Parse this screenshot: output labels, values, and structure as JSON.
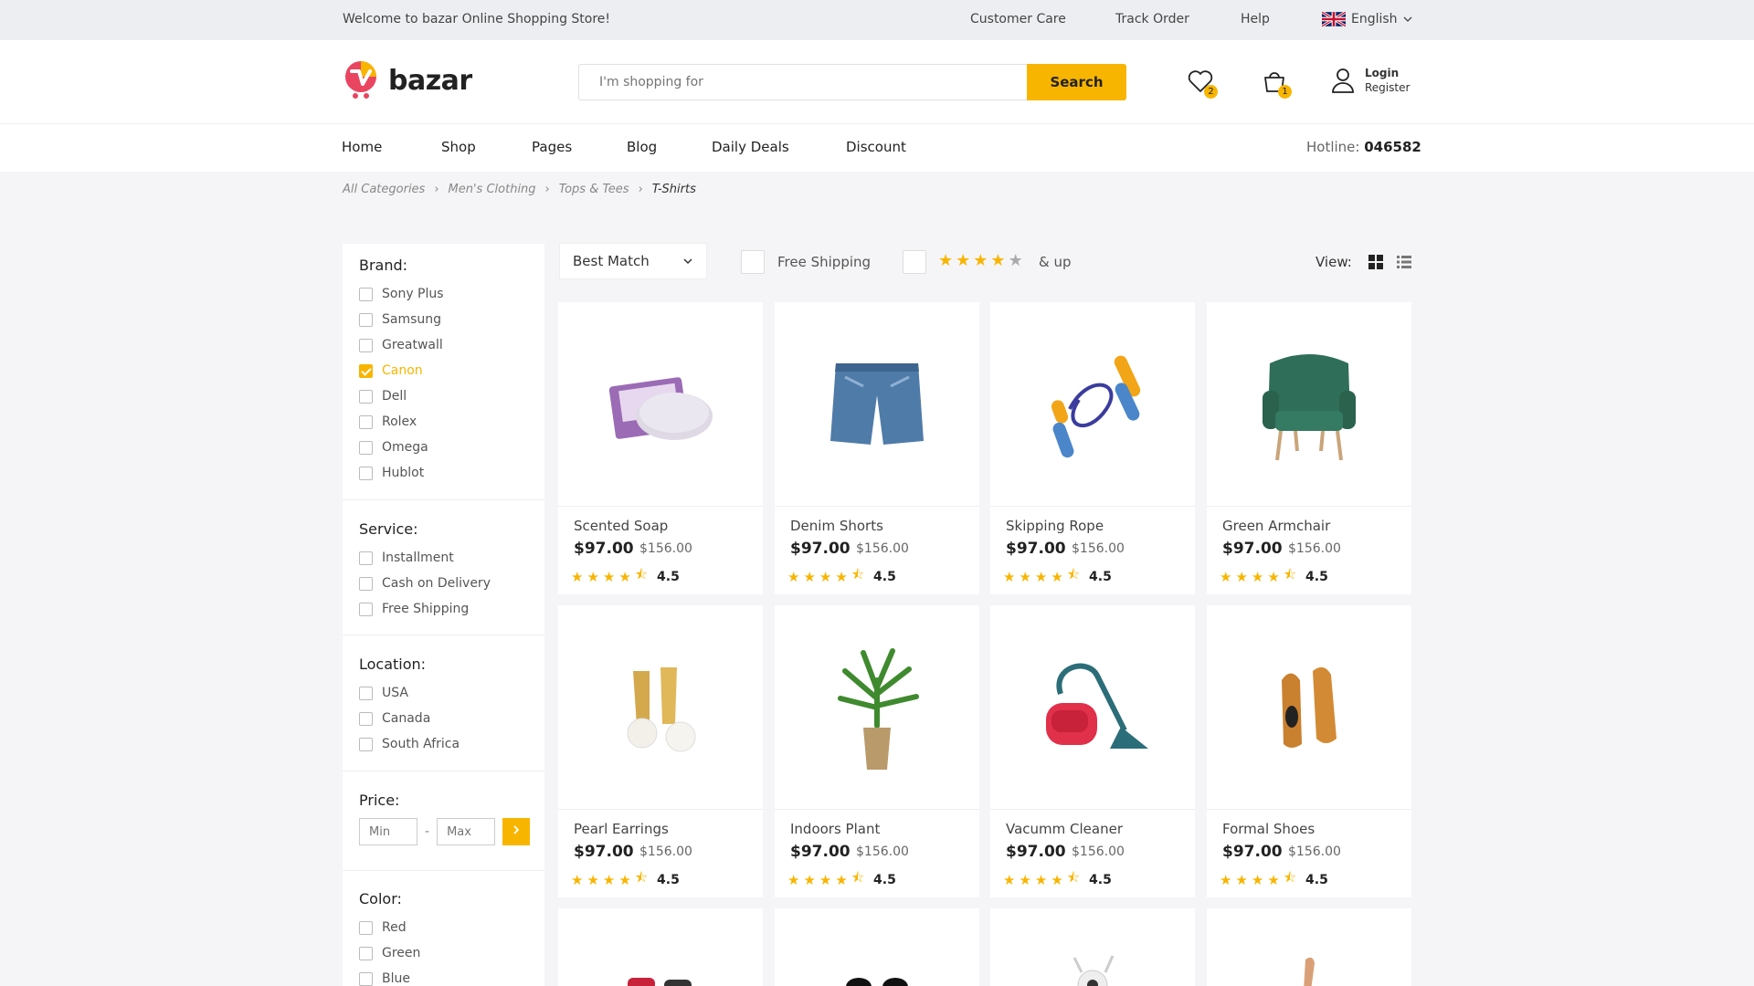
{
  "topbar": {
    "welcome": "Welcome to bazar Online Shopping Store!",
    "links": [
      "Customer Care",
      "Track Order",
      "Help"
    ],
    "language": "English"
  },
  "header": {
    "logo_text": "bazar",
    "search_placeholder": "I'm shopping for",
    "search_button": "Search",
    "wishlist_count": "2",
    "cart_count": "1",
    "login": "Login",
    "register": "Register"
  },
  "nav": {
    "items": [
      "Home",
      "Shop",
      "Pages",
      "Blog",
      "Daily Deals",
      "Discount"
    ],
    "hotline_label": "Hotline:",
    "hotline_number": "046582"
  },
  "breadcrumb": [
    "All Categories",
    "Men's Clothing",
    "Tops & Tees",
    "T-Shirts"
  ],
  "filters": {
    "brand": {
      "title": "Brand:",
      "options": [
        "Sony Plus",
        "Samsung",
        "Greatwall",
        "Canon",
        "Dell",
        "Rolex",
        "Omega",
        "Hublot"
      ],
      "checked": "Canon"
    },
    "service": {
      "title": "Service:",
      "options": [
        "Installment",
        "Cash on Delivery",
        "Free Shipping"
      ]
    },
    "location": {
      "title": "Location:",
      "options": [
        "USA",
        "Canada",
        "South Africa"
      ]
    },
    "price": {
      "title": "Price:",
      "min_placeholder": "Min",
      "max_placeholder": "Max",
      "dash": "-"
    },
    "color": {
      "title": "Color:",
      "options": [
        "Red",
        "Green",
        "Blue"
      ]
    }
  },
  "toolbar": {
    "sort": "Best Match",
    "free_shipping": "Free Shipping",
    "rating_suffix": "& up",
    "rating_filter_stars": 4,
    "view_label": "View:"
  },
  "products": [
    {
      "name": "Scented Soap",
      "price": "$97.00",
      "old_price": "$156.00",
      "rating": "4.5",
      "icon": "soap-image"
    },
    {
      "name": "Denim Shorts",
      "price": "$97.00",
      "old_price": "$156.00",
      "rating": "4.5",
      "icon": "shorts-image"
    },
    {
      "name": "Skipping Rope",
      "price": "$97.00",
      "old_price": "$156.00",
      "rating": "4.5",
      "icon": "rope-image"
    },
    {
      "name": "Green Armchair",
      "price": "$97.00",
      "old_price": "$156.00",
      "rating": "4.5",
      "icon": "armchair-image"
    },
    {
      "name": "Pearl Earrings",
      "price": "$97.00",
      "old_price": "$156.00",
      "rating": "4.5",
      "icon": "earrings-image"
    },
    {
      "name": "Indoors Plant",
      "price": "$97.00",
      "old_price": "$156.00",
      "rating": "4.5",
      "icon": "plant-image"
    },
    {
      "name": "Vacumm Cleaner",
      "price": "$97.00",
      "old_price": "$156.00",
      "rating": "4.5",
      "icon": "vacuum-image"
    },
    {
      "name": "Formal Shoes",
      "price": "$97.00",
      "old_price": "$156.00",
      "rating": "4.5",
      "icon": "shoes-image"
    }
  ],
  "colors": {
    "accent": "#f8b500",
    "topbar_bg": "#eceef1",
    "page_bg": "#f5f5f7"
  }
}
